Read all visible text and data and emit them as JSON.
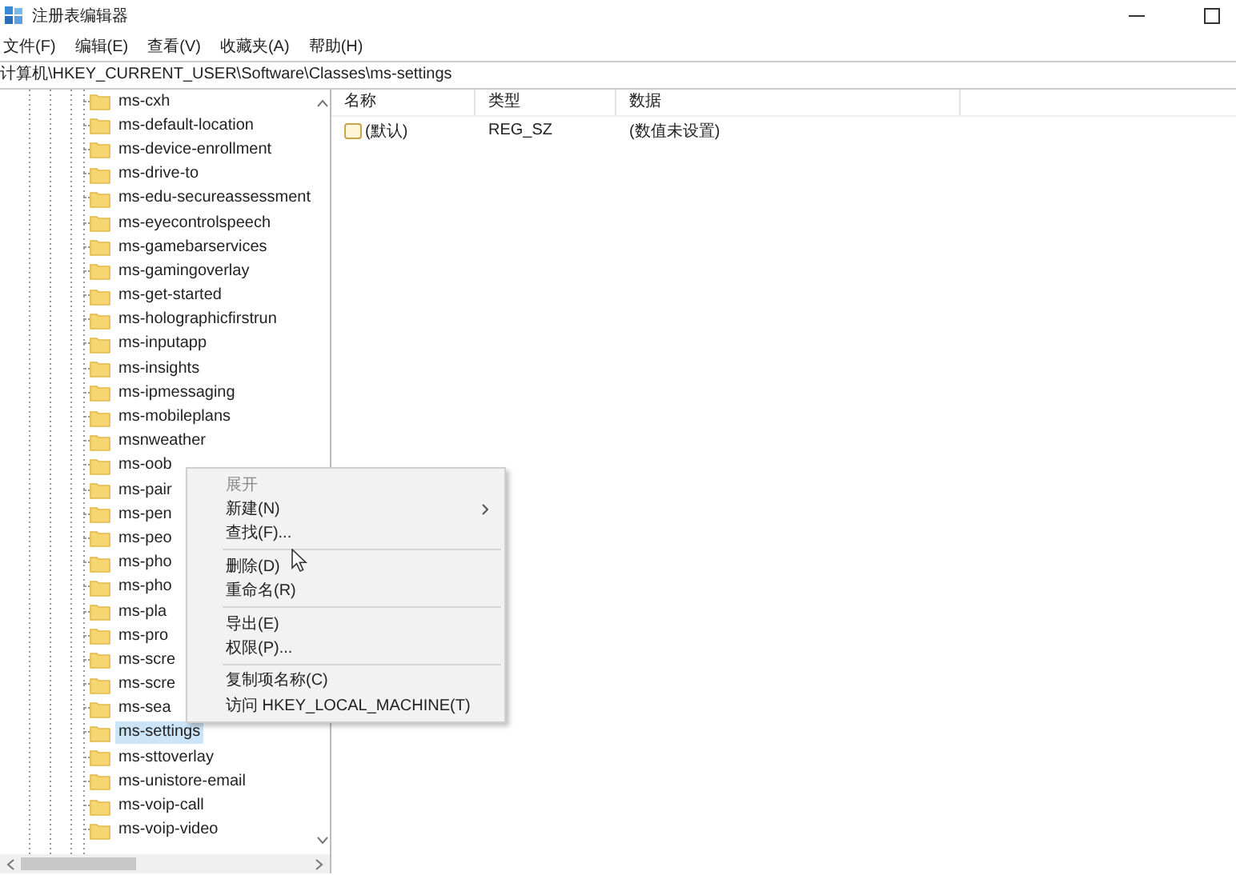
{
  "window": {
    "title": "注册表编辑器"
  },
  "menu_bar": [
    "文件(F)",
    "编辑(E)",
    "查看(V)",
    "收藏夹(A)",
    "帮助(H)"
  ],
  "address_bar": {
    "path": "计算机\\HKEY_CURRENT_USER\\Software\\Classes\\ms-settings"
  },
  "tree": {
    "items": [
      {
        "label": "ms-cxh",
        "selected": false
      },
      {
        "label": "ms-default-location",
        "selected": false
      },
      {
        "label": "ms-device-enrollment",
        "selected": false
      },
      {
        "label": "ms-drive-to",
        "selected": false
      },
      {
        "label": "ms-edu-secureassessment",
        "selected": false
      },
      {
        "label": "ms-eyecontrolspeech",
        "selected": false
      },
      {
        "label": "ms-gamebarservices",
        "selected": false
      },
      {
        "label": "ms-gamingoverlay",
        "selected": false
      },
      {
        "label": "ms-get-started",
        "selected": false
      },
      {
        "label": "ms-holographicfirstrun",
        "selected": false
      },
      {
        "label": "ms-inputapp",
        "selected": false
      },
      {
        "label": "ms-insights",
        "selected": false
      },
      {
        "label": "ms-ipmessaging",
        "selected": false
      },
      {
        "label": "ms-mobileplans",
        "selected": false
      },
      {
        "label": "msnweather",
        "selected": false
      },
      {
        "label": "ms-oob",
        "selected": false
      },
      {
        "label": "ms-pair",
        "selected": false
      },
      {
        "label": "ms-pen",
        "selected": false
      },
      {
        "label": "ms-peo",
        "selected": false
      },
      {
        "label": "ms-pho",
        "selected": false
      },
      {
        "label": "ms-pho",
        "selected": false
      },
      {
        "label": "ms-pla",
        "selected": false
      },
      {
        "label": "ms-pro",
        "selected": false
      },
      {
        "label": "ms-scre",
        "selected": false
      },
      {
        "label": "ms-scre",
        "selected": false
      },
      {
        "label": "ms-sea",
        "selected": false
      },
      {
        "label": "ms-settings",
        "selected": true
      },
      {
        "label": "ms-sttoverlay",
        "selected": false
      },
      {
        "label": "ms-unistore-email",
        "selected": false
      },
      {
        "label": "ms-voip-call",
        "selected": false
      },
      {
        "label": "ms-voip-video",
        "selected": false
      }
    ]
  },
  "values_table": {
    "columns": [
      "名称",
      "类型",
      "数据"
    ],
    "rows": [
      {
        "name": "(默认)",
        "type": "REG_SZ",
        "data": "(数值未设置)"
      }
    ]
  },
  "context_menu": {
    "items": [
      {
        "kind": "item",
        "label": "展开",
        "disabled": true,
        "submenu": false
      },
      {
        "kind": "item",
        "label": "新建(N)",
        "disabled": false,
        "submenu": true
      },
      {
        "kind": "item",
        "label": "查找(F)...",
        "disabled": false,
        "submenu": false
      },
      {
        "kind": "separator"
      },
      {
        "kind": "item",
        "label": "删除(D)",
        "disabled": false,
        "submenu": false
      },
      {
        "kind": "item",
        "label": "重命名(R)",
        "disabled": false,
        "submenu": false
      },
      {
        "kind": "separator"
      },
      {
        "kind": "item",
        "label": "导出(E)",
        "disabled": false,
        "submenu": false
      },
      {
        "kind": "item",
        "label": "权限(P)...",
        "disabled": false,
        "submenu": false
      },
      {
        "kind": "separator"
      },
      {
        "kind": "item",
        "label": "复制项名称(C)",
        "disabled": false,
        "submenu": false
      },
      {
        "kind": "item",
        "label": "访问 HKEY_LOCAL_MACHINE(T)",
        "disabled": false,
        "submenu": false
      }
    ]
  }
}
